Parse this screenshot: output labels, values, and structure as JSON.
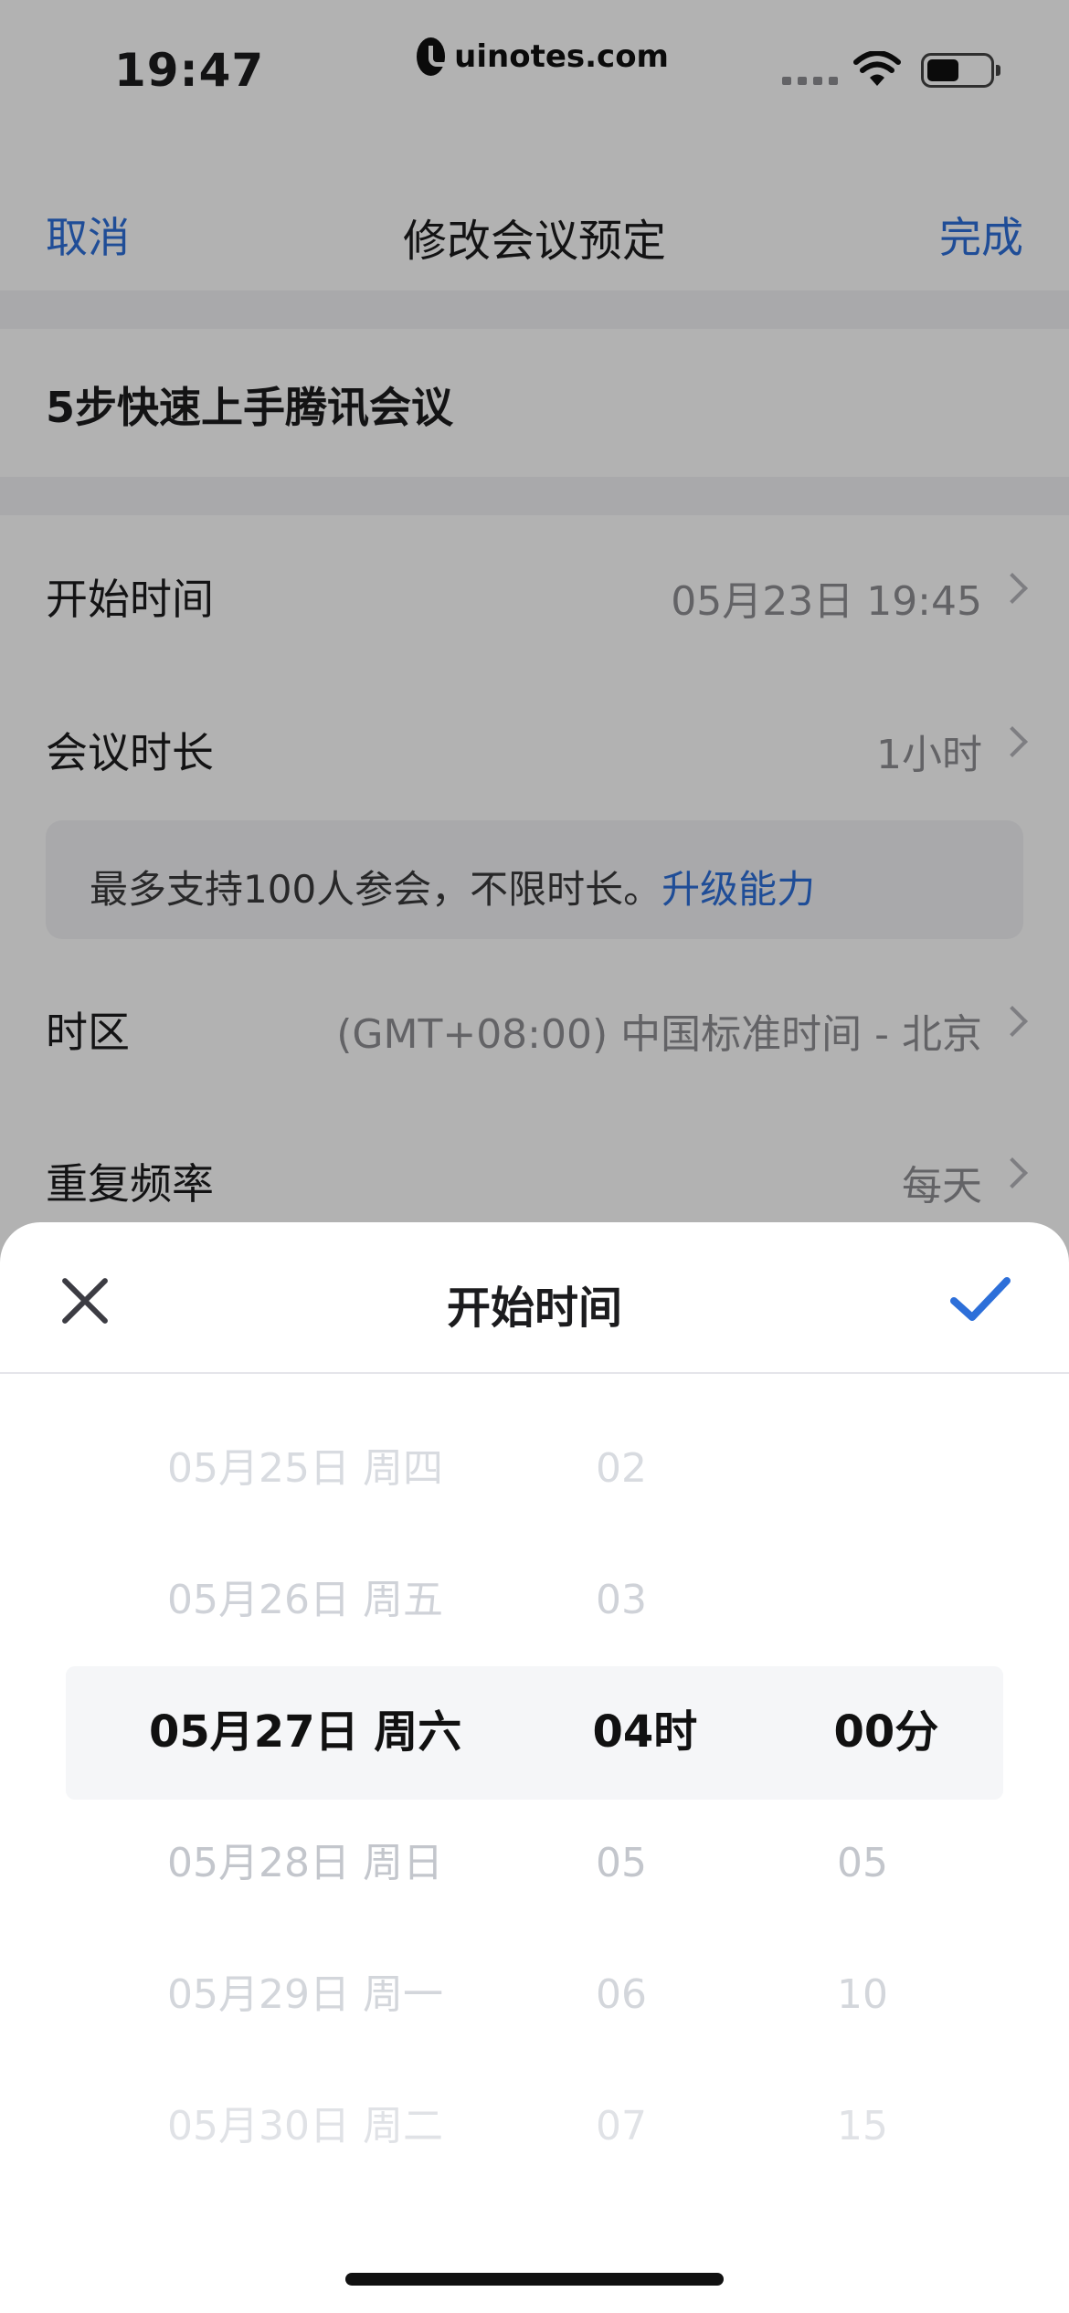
{
  "status_bar": {
    "time": "19:47",
    "watermark": "uinotes.com"
  },
  "nav": {
    "cancel_label": "取消",
    "title": "修改会议预定",
    "done_label": "完成"
  },
  "meeting": {
    "title": "5步快速上手腾讯会议"
  },
  "rows": {
    "start_time": {
      "label": "开始时间",
      "value": "05月23日 19:45"
    },
    "duration": {
      "label": "会议时长",
      "value": "1小时"
    },
    "timezone": {
      "label": "时区",
      "value": "(GMT+08:00) 中国标准时间 - 北京"
    },
    "repeat": {
      "label": "重复频率",
      "value": "每天"
    }
  },
  "notice": {
    "text": "最多支持100人参会，不限时长。",
    "link": "升级能力"
  },
  "sheet": {
    "title": "开始时间",
    "picker": {
      "dates": [
        "05月25日 周四",
        "05月26日 周五",
        "05月27日 周六",
        "05月28日 周日",
        "05月29日 周一",
        "05月30日 周二"
      ],
      "selected_date": 2,
      "hours": [
        "02",
        "03",
        "04时",
        "05",
        "06",
        "07"
      ],
      "selected_hour": 2,
      "minutes": [
        "",
        "",
        "00分",
        "05",
        "10",
        "15"
      ],
      "selected_minute": 2
    }
  },
  "colors": {
    "accent": "#2d6fd9"
  }
}
